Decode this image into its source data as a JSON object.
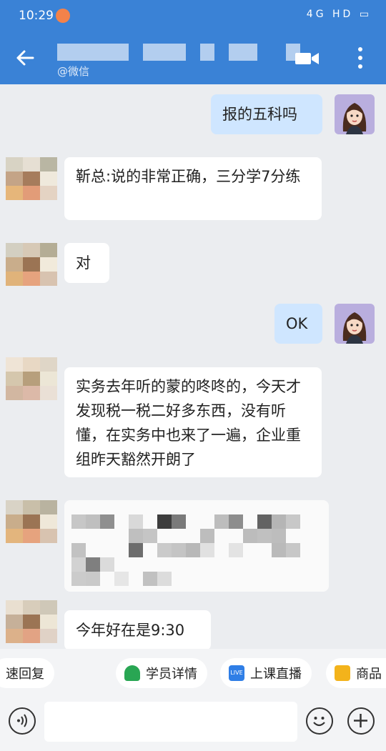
{
  "status_bar": {
    "time": "10:29",
    "indicators": "4G HD"
  },
  "header": {
    "subtitle": "@微信"
  },
  "messages": [
    {
      "text": "报的五科吗"
    },
    {
      "text": "靳总:说的非常正确，三分学7分练"
    },
    {
      "text": "对"
    },
    {
      "text": "OK"
    },
    {
      "text": "实务去年听的蒙的咚咚的，今天才发现税一税二好多东西，没有听懂，在实务中也来了一遍，企业重组昨天豁然开朗了"
    },
    {
      "text": "今年好在是9:30"
    }
  ],
  "toolbar": {
    "quick_reply": "速回复",
    "student_details": "学员详情",
    "live_class": "上课直播",
    "products": "商品",
    "live_badge": "LIVE"
  },
  "input": {
    "placeholder": ""
  },
  "colors": {
    "brand": "#3a82d6",
    "incoming_bubble": "#ffffff",
    "outgoing_bubble": "#cfe6ff",
    "background": "#ebedf0"
  }
}
